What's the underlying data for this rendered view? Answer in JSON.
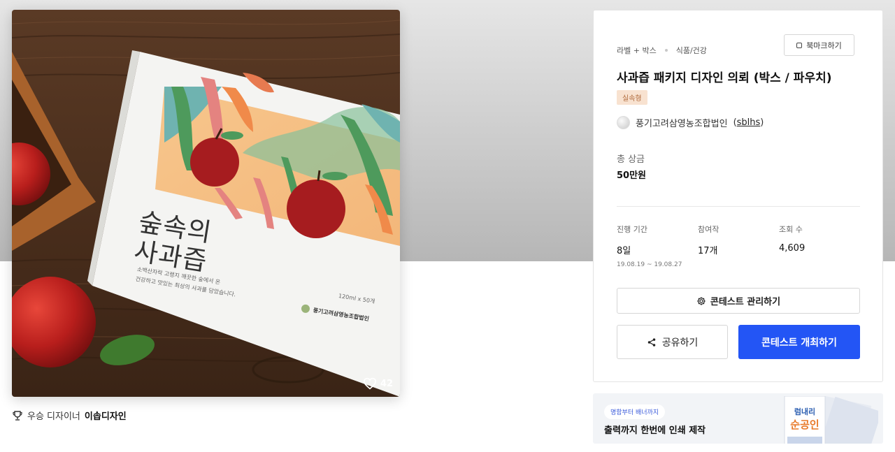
{
  "hero": {
    "package_title_line1": "숲속의",
    "package_title_line2": "사과즙",
    "package_desc_line1": "소백산자락 고랭지 깨끗한 숲에서 온",
    "package_desc_line2": "건강하고 맛있는 최상의 사과를 담았습니다.",
    "package_volume": "120ml x 50개",
    "package_brand": "풍기고려삼영농조합법인",
    "like_count": "42"
  },
  "winner": {
    "prefix": "우승 디자이너",
    "name": "이솝디자인"
  },
  "card": {
    "category": "라벨 + 박스",
    "subcategory": "식품/건강",
    "bookmark_label": "북마크하기",
    "title": "사과즙 패키지 디자인 의뢰 (박스 / 파우치)",
    "type_badge": "실속형",
    "host_name": "풍기고려삼영농조합법인",
    "host_handle": "sblhs",
    "prize_label": "총 상금",
    "prize_value": "50만원",
    "stats": {
      "period_label": "진행 기간",
      "period_value": "8일",
      "period_range": "19.08.19 ~ 19.08.27",
      "entries_label": "참여작",
      "entries_value": "17개",
      "views_label": "조회 수",
      "views_value": "4,609"
    },
    "manage_label": "콘테스트 관리하기",
    "share_label": "공유하기",
    "host_contest_label": "콘테스트 개최하기"
  },
  "banner": {
    "pill": "명함부터 배너까지",
    "headline": "출력까지 한번에 인쇄 제작",
    "poster_text_line1": "럼내리",
    "poster_text_line2": "순공인"
  },
  "colors": {
    "primary": "#2355f5",
    "badge_bg": "#f8e2d0",
    "badge_text": "#b06a3c"
  }
}
